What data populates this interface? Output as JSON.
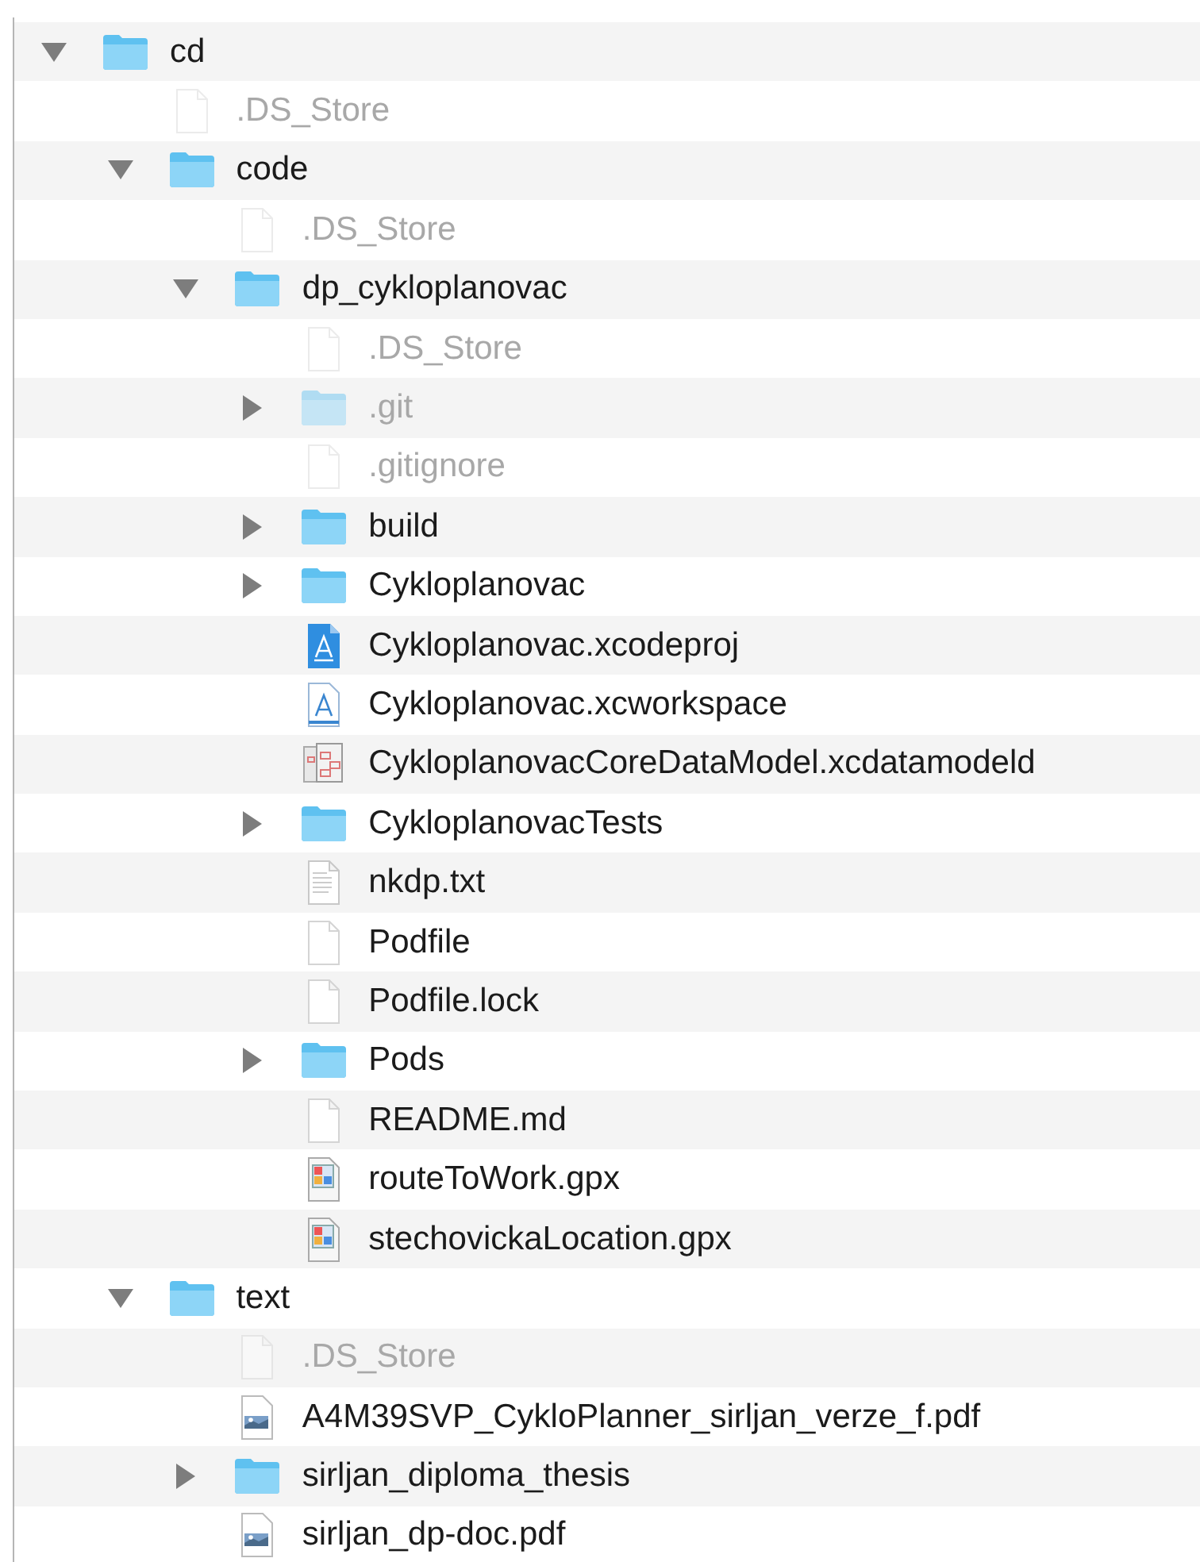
{
  "tree": [
    {
      "name": "cd",
      "kind": "folder",
      "expanded": true,
      "hidden": false,
      "children": [
        {
          "name": ".DS_Store",
          "kind": "file",
          "hidden": true
        },
        {
          "name": "code",
          "kind": "folder",
          "expanded": true,
          "hidden": false,
          "children": [
            {
              "name": ".DS_Store",
              "kind": "file",
              "hidden": true
            },
            {
              "name": "dp_cykloplanovac",
              "kind": "folder",
              "expanded": true,
              "hidden": false,
              "children": [
                {
                  "name": ".DS_Store",
                  "kind": "file",
                  "hidden": true
                },
                {
                  "name": ".git",
                  "kind": "folder",
                  "expanded": false,
                  "hidden": true
                },
                {
                  "name": ".gitignore",
                  "kind": "file",
                  "hidden": true
                },
                {
                  "name": "build",
                  "kind": "folder",
                  "expanded": false,
                  "hidden": false
                },
                {
                  "name": "Cykloplanovac",
                  "kind": "folder",
                  "expanded": false,
                  "hidden": false
                },
                {
                  "name": "Cykloplanovac.xcodeproj",
                  "kind": "project",
                  "hidden": false
                },
                {
                  "name": "Cykloplanovac.xcworkspace",
                  "kind": "workspace",
                  "hidden": false
                },
                {
                  "name": "CykloplanovacCoreDataModel.xcdatamodeld",
                  "kind": "datamodel",
                  "hidden": false
                },
                {
                  "name": "CykloplanovacTests",
                  "kind": "folder",
                  "expanded": false,
                  "hidden": false
                },
                {
                  "name": "nkdp.txt",
                  "kind": "text",
                  "hidden": false
                },
                {
                  "name": "Podfile",
                  "kind": "file",
                  "hidden": false
                },
                {
                  "name": "Podfile.lock",
                  "kind": "file",
                  "hidden": false
                },
                {
                  "name": "Pods",
                  "kind": "folder",
                  "expanded": false,
                  "hidden": false
                },
                {
                  "name": "README.md",
                  "kind": "file",
                  "hidden": false
                },
                {
                  "name": "routeToWork.gpx",
                  "kind": "gpx",
                  "hidden": false
                },
                {
                  "name": "stechovickaLocation.gpx",
                  "kind": "gpx",
                  "hidden": false
                }
              ]
            }
          ]
        },
        {
          "name": "text",
          "kind": "folder",
          "expanded": true,
          "hidden": false,
          "children": [
            {
              "name": ".DS_Store",
              "kind": "file",
              "hidden": true
            },
            {
              "name": "A4M39SVP_CykloPlanner_sirljan_verze_f.pdf",
              "kind": "pdf",
              "hidden": false
            },
            {
              "name": "sirljan_diploma_thesis",
              "kind": "folder",
              "expanded": false,
              "hidden": false
            },
            {
              "name": "sirljan_dp-doc.pdf",
              "kind": "pdf",
              "hidden": false
            }
          ]
        }
      ]
    }
  ]
}
